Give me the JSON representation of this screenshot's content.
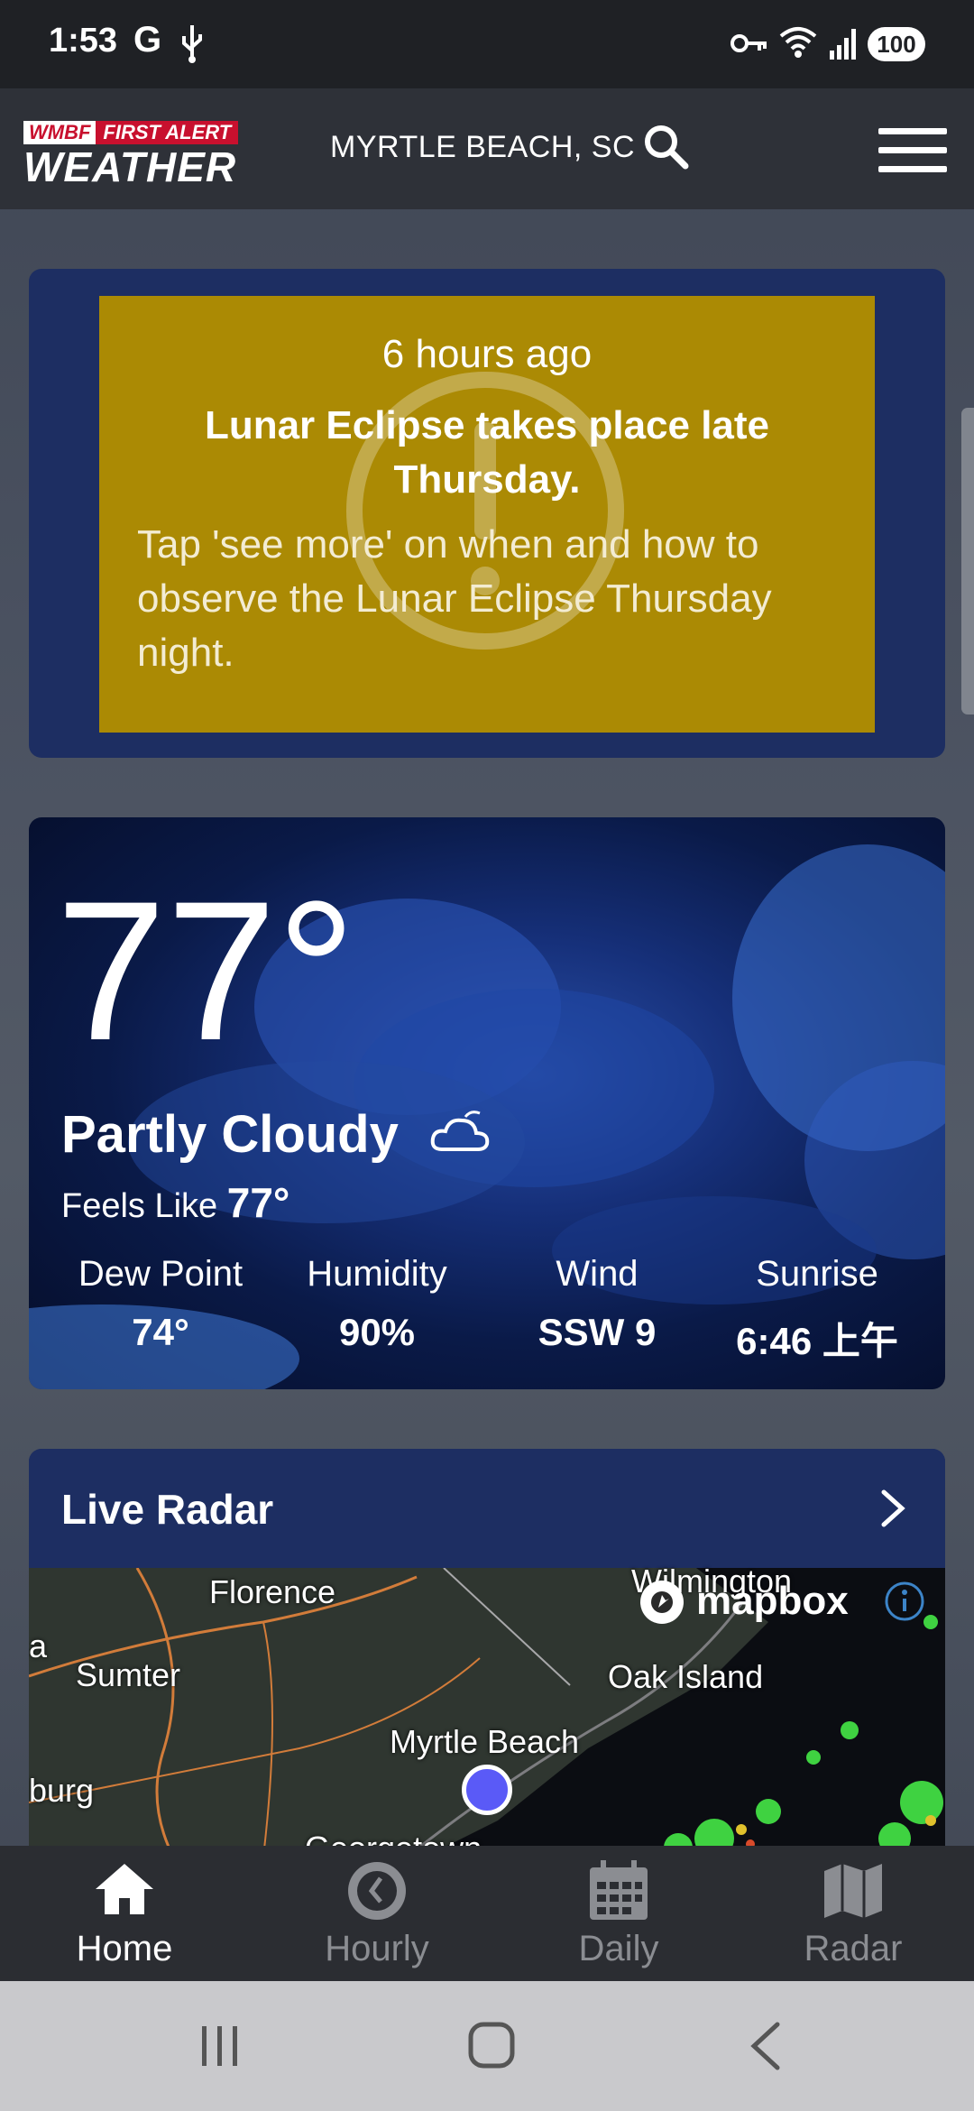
{
  "status_bar": {
    "time": "1:53",
    "carrier_icon": "G",
    "battery": "100"
  },
  "header": {
    "logo_station": "WMBF",
    "logo_alert": "FIRST ALERT",
    "logo_weather": "WEATHER",
    "location": "MYRTLE BEACH, SC"
  },
  "alert": {
    "time": "6 hours ago",
    "title": "Lunar Eclipse takes place late Thursday.",
    "body": "Tap 'see more' on when and how to observe the Lunar Eclipse Thursday night.",
    "color": "#ab8a04"
  },
  "conditions": {
    "temperature": "77°",
    "summary": "Partly Cloudy",
    "feels_label": "Feels Like",
    "feels_value": "77°",
    "stats": [
      {
        "label": "Dew Point",
        "value": "74°"
      },
      {
        "label": "Humidity",
        "value": "90%"
      },
      {
        "label": "Wind",
        "value": "SSW 9"
      },
      {
        "label": "Sunrise",
        "value": "6:46 上午"
      }
    ]
  },
  "radar": {
    "title": "Live Radar",
    "attribution": "mapbox",
    "places": [
      "Florence",
      "Wilmington",
      "Sumter",
      "Oak Island",
      "Myrtle Beach",
      "Georgetown",
      "burg",
      "a"
    ]
  },
  "nav": {
    "items": [
      {
        "label": "Home",
        "icon": "home-icon"
      },
      {
        "label": "Hourly",
        "icon": "clock-icon"
      },
      {
        "label": "Daily",
        "icon": "calendar-icon"
      },
      {
        "label": "Radar",
        "icon": "map-icon"
      }
    ]
  }
}
